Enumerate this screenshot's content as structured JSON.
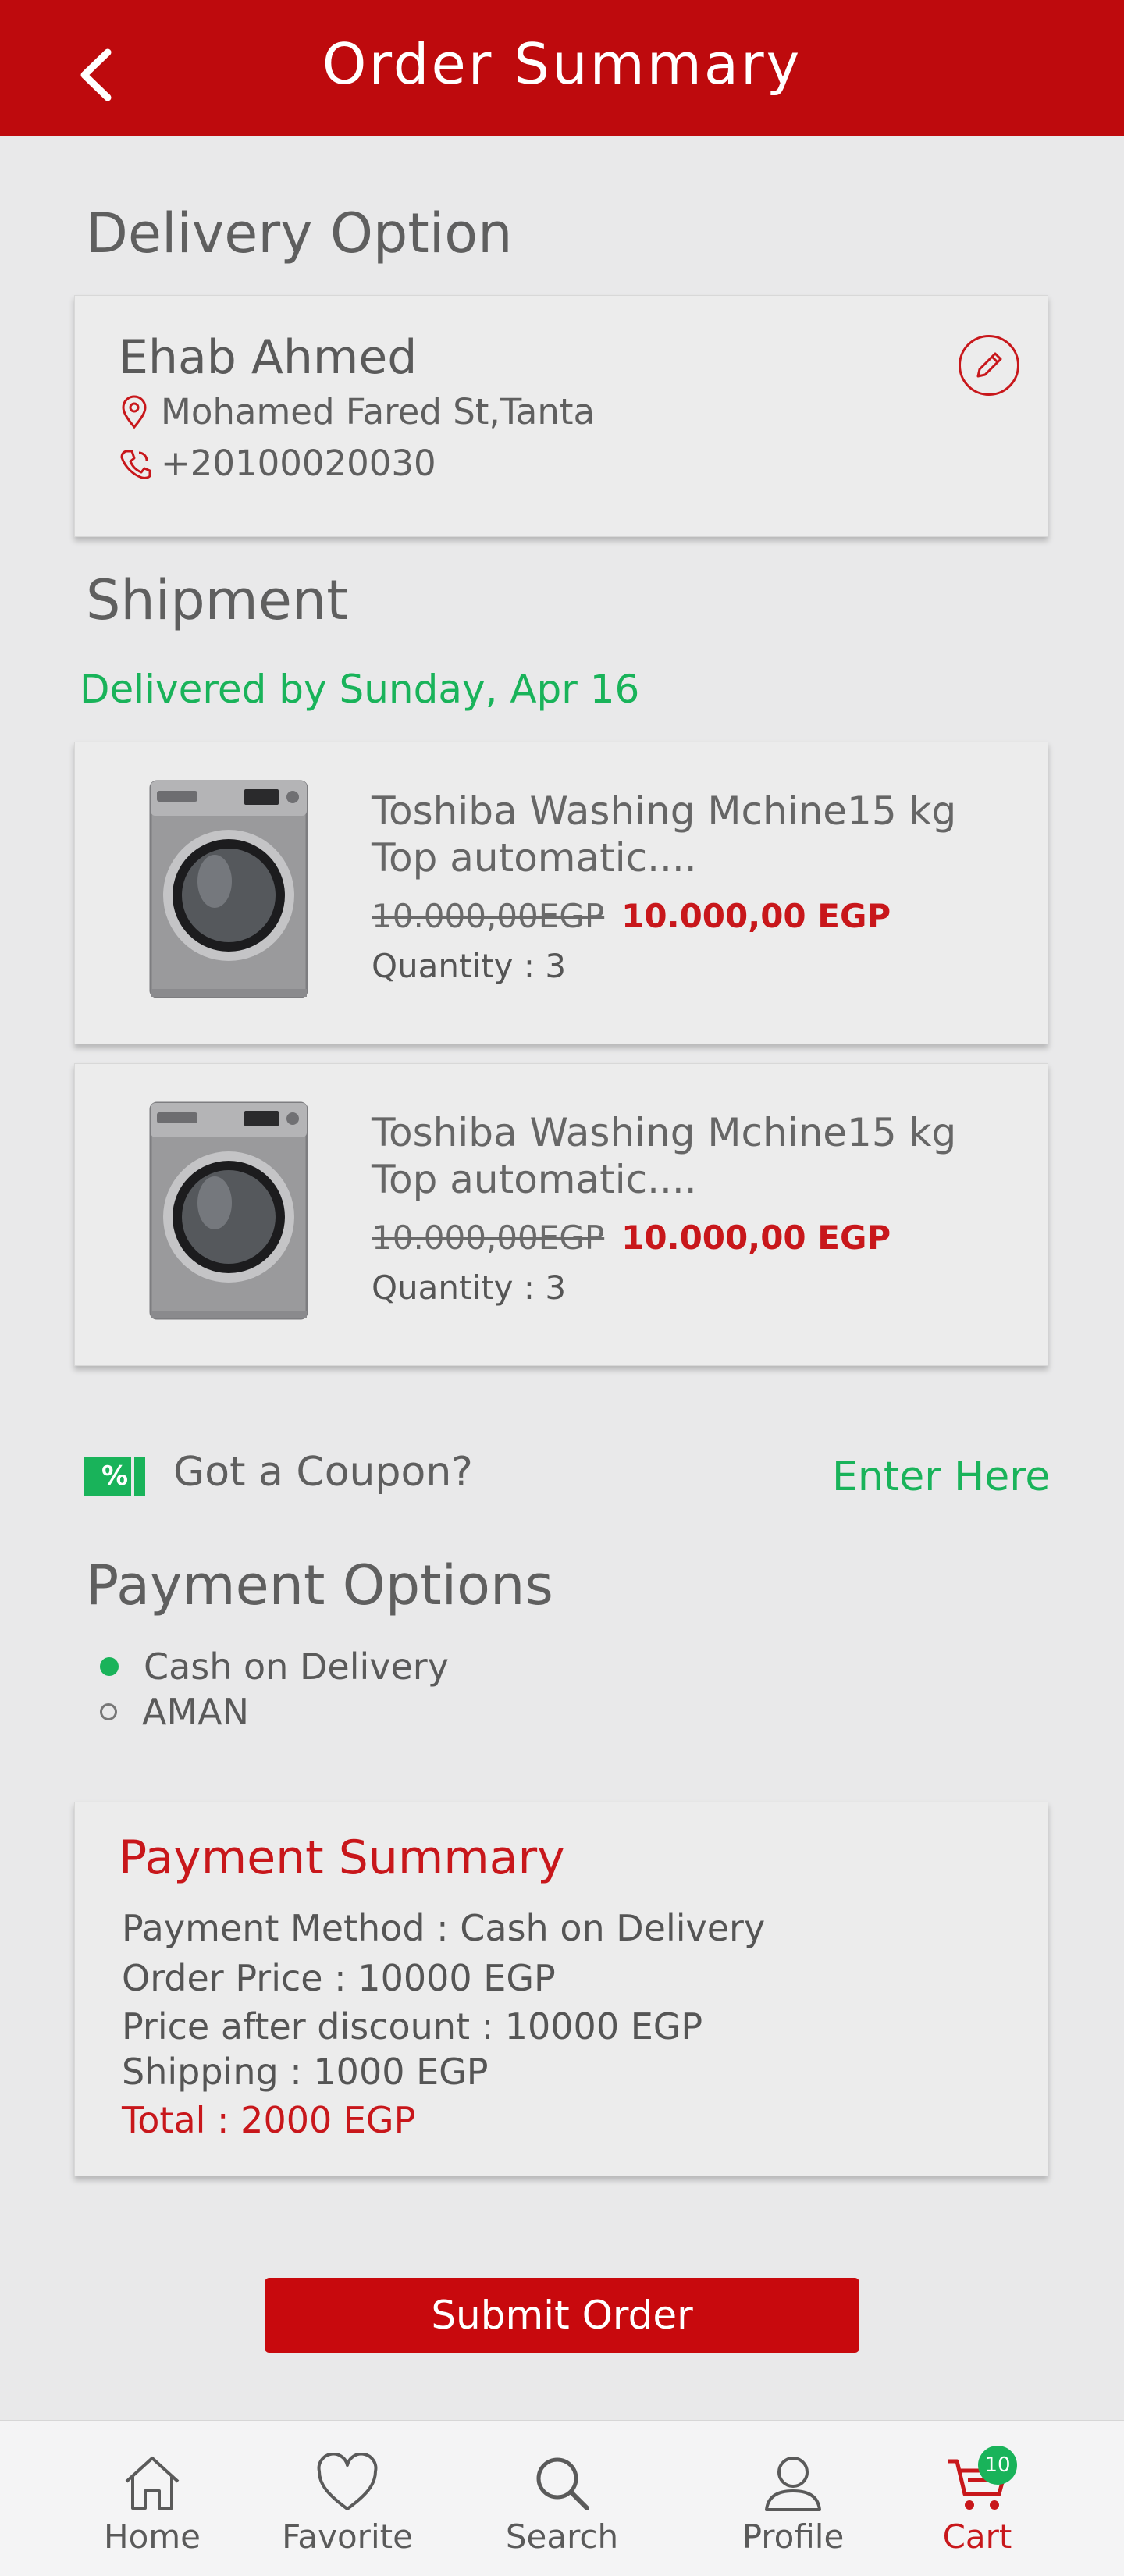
{
  "header": {
    "title": "Order Summary",
    "back_icon": "chevron-left-icon"
  },
  "delivery": {
    "section_title": "Delivery Option",
    "name": "Ehab Ahmed",
    "address": "Mohamed Fared St,Tanta",
    "phone": "+20100020030",
    "edit_icon": "pencil-icon"
  },
  "shipment": {
    "section_title": "Shipment",
    "delivery_date": "Delivered by Sunday, Apr 16",
    "items": [
      {
        "name": "Toshiba Washing Mchine15 kg Top automatic....",
        "old_price": "10.000,00EGP",
        "price": "10.000,00 EGP",
        "quantity": "Quantity : 3"
      },
      {
        "name": "Toshiba Washing Mchine15 kg Top automatic....",
        "old_price": "10.000,00EGP",
        "price": "10.000,00 EGP",
        "quantity": "Quantity : 3"
      }
    ]
  },
  "coupon": {
    "icon_text": "%",
    "label": "Got a Coupon?",
    "link": "Enter Here"
  },
  "payment": {
    "section_title": "Payment Options",
    "options": [
      {
        "label": "Cash on Delivery",
        "selected": true
      },
      {
        "label": "AMAN",
        "selected": false
      }
    ]
  },
  "summary": {
    "title": "Payment Summary",
    "method": "Payment Method : Cash on Delivery",
    "order_price": "Order Price : 10000 EGP",
    "after_discount": "Price after discount : 10000 EGP",
    "shipping": "Shipping : 1000 EGP",
    "total": "Total : 2000 EGP"
  },
  "submit_label": "Submit Order",
  "nav": {
    "items": [
      {
        "label": "Home",
        "icon": "home-icon"
      },
      {
        "label": "Favorite",
        "icon": "heart-icon"
      },
      {
        "label": "Search",
        "icon": "search-icon"
      },
      {
        "label": "Profile",
        "icon": "user-icon"
      },
      {
        "label": "Cart",
        "icon": "cart-icon",
        "badge": "10",
        "active": true
      }
    ]
  },
  "colors": {
    "brand_red": "#be0a0d",
    "accent_green": "#19b35a",
    "background": "#e9e9ea"
  }
}
